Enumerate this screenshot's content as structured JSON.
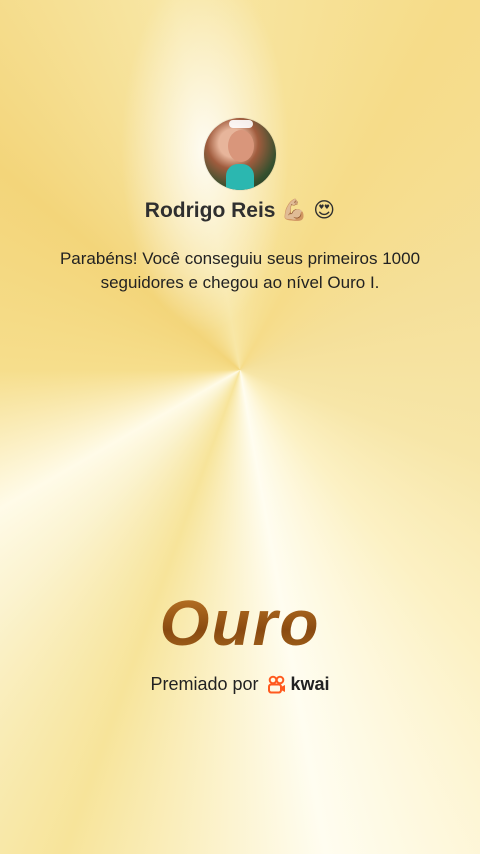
{
  "profile": {
    "name": "Rodrigo Reis 💪🏼 😍"
  },
  "message": "Parabéns! Você conseguiu seus primeiros 1000 seguidores e chegou ao nível Ouro I.",
  "rank": "Ouro",
  "award": {
    "label": "Premiado por",
    "brand": "kwai",
    "brand_icon": "kwai-logo-icon",
    "brand_color": "#ff5a1f"
  }
}
